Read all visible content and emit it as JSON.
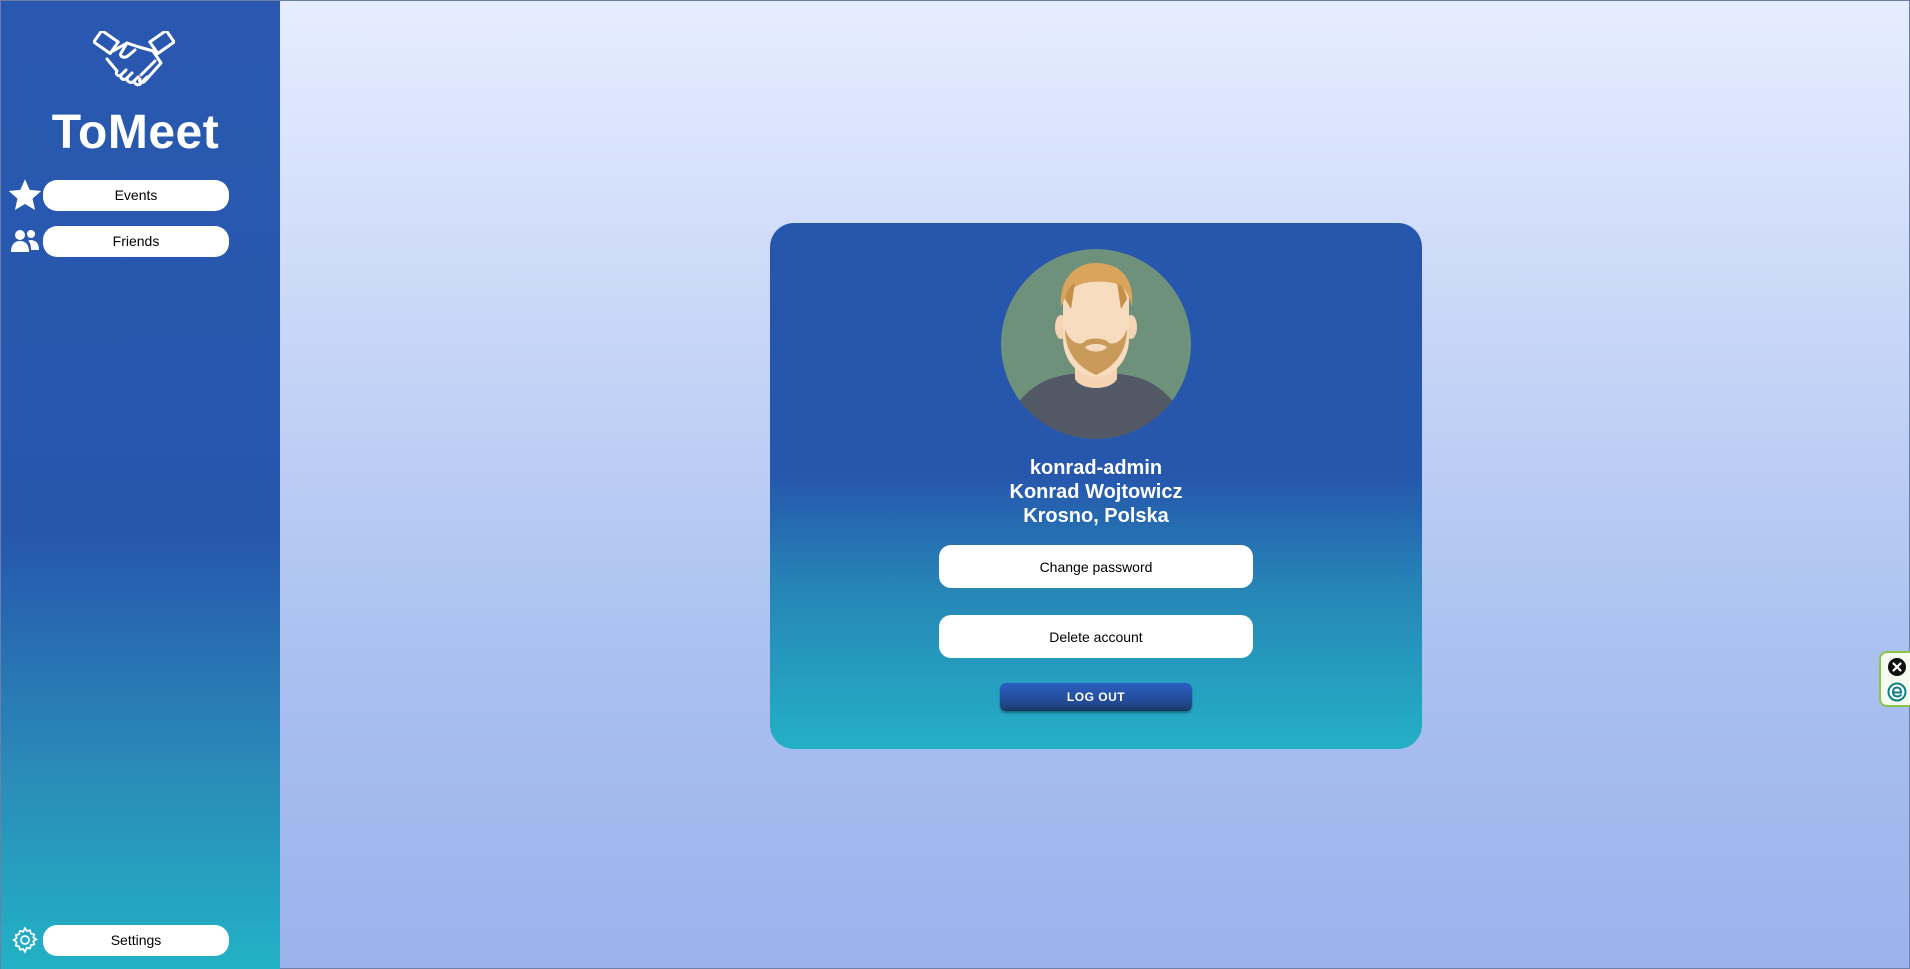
{
  "app": {
    "title": "ToMeet",
    "logo_icon": "handshake-icon",
    "colors": {
      "sidebar_top": "#2a58b0",
      "sidebar_bottom": "#22b2c6",
      "card_top": "#2657ad",
      "card_bottom": "#24b0c6",
      "page_bg_top": "#e6edff",
      "page_bg_bottom": "#9bb3ec"
    }
  },
  "sidebar": {
    "items": [
      {
        "label": "Events",
        "icon": "star-icon"
      },
      {
        "label": "Friends",
        "icon": "users-icon"
      }
    ],
    "settings": {
      "label": "Settings",
      "icon": "gear-icon"
    }
  },
  "profile": {
    "avatar": "user-avatar",
    "username": "konrad-admin",
    "full_name": "Konrad Wojtowicz",
    "location": "Krosno, Polska",
    "change_password_label": "Change password",
    "delete_account_label": "Delete account",
    "logout_label": "LOG OUT"
  },
  "extension_widget": {
    "icons": [
      "close-circle-icon",
      "extension-e-icon"
    ]
  }
}
